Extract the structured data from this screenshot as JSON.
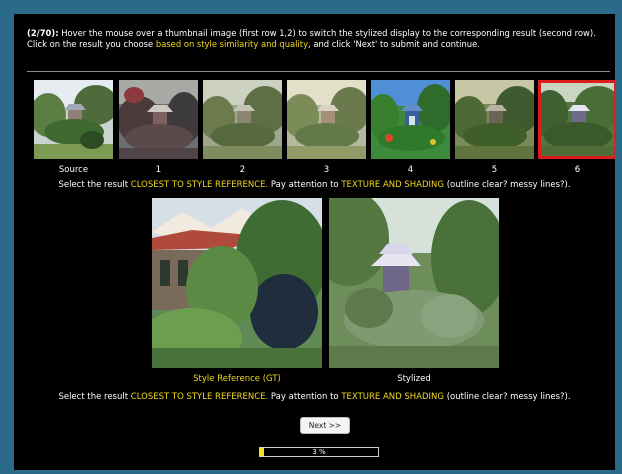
{
  "instructions": {
    "counter": "(2/70):",
    "line1": "Hover the mouse over a thumbnail image (first row 1,2) to switch the stylized display to the corresponding result (second row).",
    "line2_prefix": "Click on the result you choose ",
    "line2_highlight": "based on style similarity and quality",
    "line2_suffix": ", and click 'Next' to submit and continue."
  },
  "thumbnails": [
    {
      "label": "Source",
      "selected": false
    },
    {
      "label": "1",
      "selected": false
    },
    {
      "label": "2",
      "selected": false
    },
    {
      "label": "3",
      "selected": false
    },
    {
      "label": "4",
      "selected": false
    },
    {
      "label": "5",
      "selected": false
    },
    {
      "label": "6",
      "selected": true
    }
  ],
  "select_prompt": {
    "prefix": "Select the result ",
    "h1": "CLOSEST TO STYLE REFERENCE.",
    "mid": " Pay attention to ",
    "h2": "TEXTURE AND SHADING",
    "suffix": " (outline clear? messy lines?)."
  },
  "style_reference_label": "Style Reference (GT)",
  "stylized_label": "Stylized",
  "next_button": "Next >>",
  "progress": {
    "text": "3 %",
    "value": 0.03
  },
  "colors": {
    "background": "#2c6a89",
    "highlight": "#f0d820",
    "selected_border": "#dd1c1c"
  }
}
